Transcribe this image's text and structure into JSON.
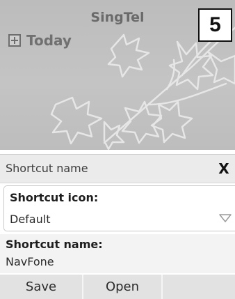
{
  "home": {
    "operator": "SingTel",
    "today_label": "Today",
    "step_badge": "5"
  },
  "dialog": {
    "title": "Shortcut name",
    "close_label": "X",
    "shortcut_icon": {
      "label": "Shortcut icon:",
      "value": "Default"
    },
    "shortcut_name": {
      "label": "Shortcut name:",
      "value": "NavFone"
    }
  },
  "softkeys": {
    "left": "Save",
    "middle": "Open"
  },
  "icons": {
    "expand": "plus-box-icon",
    "dropdown": "chevron-down-icon",
    "wallpaper": "maple-leaf-wallpaper"
  }
}
